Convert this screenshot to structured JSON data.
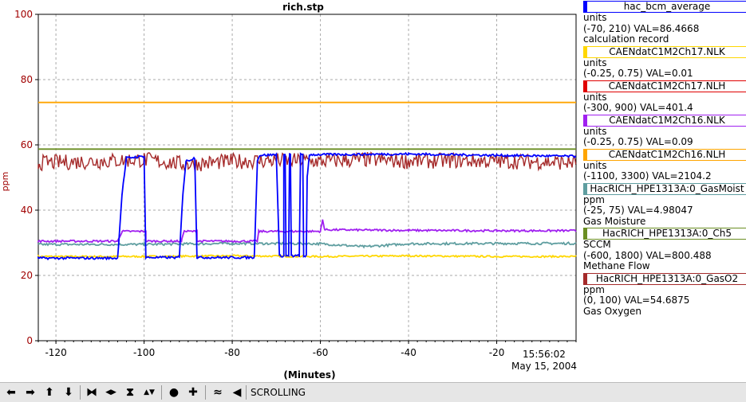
{
  "chart_data": {
    "type": "line",
    "title": "rich.stp",
    "xlabel": "(Minutes)",
    "ylabel": "ppm",
    "xlim": [
      -124,
      -2
    ],
    "ylim": [
      0,
      100
    ],
    "xticks": [
      -120,
      -100,
      -80,
      -60,
      -40,
      -20
    ],
    "yticks": [
      0,
      20,
      40,
      60,
      80,
      100
    ],
    "grid": true,
    "timestamp_time": "15:56:02",
    "timestamp_date": "May 15, 2004",
    "series": [
      {
        "name": "hac_bcm_average",
        "color": "#0000ff",
        "points": [
          [
            -124,
            25.3
          ],
          [
            -106,
            25.3
          ],
          [
            -105,
            45
          ],
          [
            -104,
            56
          ],
          [
            -100,
            56.5
          ],
          [
            -99.6,
            25.5
          ],
          [
            -92,
            25.5
          ],
          [
            -91.2,
            45
          ],
          [
            -90.5,
            55
          ],
          [
            -88.5,
            56
          ],
          [
            -88,
            25.5
          ],
          [
            -80,
            25.5
          ],
          [
            -75,
            25.5
          ],
          [
            -74.3,
            55
          ],
          [
            -73.8,
            56.8
          ],
          [
            -70,
            57
          ],
          [
            -69.3,
            26
          ],
          [
            -68.3,
            26
          ],
          [
            -68.3,
            57
          ],
          [
            -68,
            57
          ],
          [
            -67.8,
            26
          ],
          [
            -67.2,
            26
          ],
          [
            -67,
            57
          ],
          [
            -66.8,
            57
          ],
          [
            -66.6,
            26
          ],
          [
            -64.8,
            26
          ],
          [
            -64.5,
            57
          ],
          [
            -64,
            57
          ],
          [
            -63.8,
            26
          ],
          [
            -63.2,
            26
          ],
          [
            -63,
            50
          ],
          [
            -62.5,
            57
          ],
          [
            -40,
            57.2
          ],
          [
            -20,
            56.8
          ],
          [
            -2,
            56.5
          ]
        ]
      },
      {
        "name": "CAENdatC1M2Ch17.NLK",
        "color": "#ffd700",
        "points": [
          [
            -124,
            25.8
          ],
          [
            -100,
            25.8
          ],
          [
            -80,
            26
          ],
          [
            -60,
            25.8
          ],
          [
            -40,
            26
          ],
          [
            -20,
            25.8
          ],
          [
            -2,
            25.8
          ]
        ]
      },
      {
        "name": "CAENdatC1M2Ch17.NLH",
        "color": "#e00000",
        "points": []
      },
      {
        "name": "CAENdatC1M2Ch16.NLK",
        "color": "#a020f0",
        "points": [
          [
            -124,
            30.5
          ],
          [
            -106,
            30.5
          ],
          [
            -105,
            33.5
          ],
          [
            -99.6,
            33.5
          ],
          [
            -99.6,
            30.5
          ],
          [
            -91.5,
            30.5
          ],
          [
            -91,
            33.5
          ],
          [
            -88,
            33.5
          ],
          [
            -88,
            30.5
          ],
          [
            -74.3,
            30.5
          ],
          [
            -74,
            33.5
          ],
          [
            -60,
            33.5
          ],
          [
            -59.5,
            37
          ],
          [
            -59,
            34
          ],
          [
            -40,
            33.8
          ],
          [
            -20,
            33.7
          ],
          [
            -2,
            33.7
          ]
        ]
      },
      {
        "name": "CAENdatC1M2Ch16.NLH",
        "color": "#ffa500",
        "points": [
          [
            -124,
            73
          ],
          [
            -2,
            73
          ]
        ]
      },
      {
        "name": "HacRICH_HPE1313A:0_GasMoist",
        "color": "#5f9ea0",
        "points": [
          [
            -124,
            29.5
          ],
          [
            -100,
            29.5
          ],
          [
            -80,
            29.8
          ],
          [
            -60,
            29.7
          ],
          [
            -50,
            28.8
          ],
          [
            -40,
            29.7
          ],
          [
            -20,
            29.8
          ],
          [
            -2,
            29.8
          ]
        ]
      },
      {
        "name": "HacRICH_HPE1313A:0_Ch5",
        "color": "#6b8e23",
        "points": [
          [
            -124,
            58.7
          ],
          [
            -2,
            58.7
          ]
        ]
      },
      {
        "name": "HacRICH_HPE1313A:0_GasO2",
        "color": "#a52a2a",
        "points": [
          [
            -124,
            54.5
          ],
          [
            -110,
            55
          ],
          [
            -100,
            55.5
          ],
          [
            -90,
            54
          ],
          [
            -80,
            55
          ],
          [
            -70,
            55.2
          ],
          [
            -60,
            55
          ],
          [
            -50,
            55.5
          ],
          [
            -40,
            55
          ],
          [
            -30,
            55.2
          ],
          [
            -20,
            55
          ],
          [
            -10,
            54.8
          ],
          [
            -2,
            54.5
          ]
        ]
      }
    ]
  },
  "legend": [
    {
      "name": "hac_bcm_average",
      "color": "#0000ff",
      "lines": [
        "units",
        "(-70, 210) VAL=86.4668",
        "calculation record"
      ]
    },
    {
      "name": "CAENdatC1M2Ch17.NLK",
      "color": "#ffd700",
      "lines": [
        "units",
        "(-0.25, 0.75) VAL=0.01"
      ]
    },
    {
      "name": "CAENdatC1M2Ch17.NLH",
      "color": "#e00000",
      "lines": [
        "units",
        "(-300, 900) VAL=401.4"
      ]
    },
    {
      "name": "CAENdatC1M2Ch16.NLK",
      "color": "#a020f0",
      "lines": [
        "units",
        "(-0.25, 0.75) VAL=0.09"
      ]
    },
    {
      "name": "CAENdatC1M2Ch16.NLH",
      "color": "#ffa500",
      "lines": [
        "units",
        "(-1100, 3300) VAL=2104.2"
      ]
    },
    {
      "name": "HacRICH_HPE1313A:0_GasMoist",
      "color": "#5f9ea0",
      "lines": [
        "ppm",
        "(-25, 75) VAL=4.98047",
        "Gas Moisture"
      ]
    },
    {
      "name": "HacRICH_HPE1313A:0_Ch5",
      "color": "#6b8e23",
      "lines": [
        "SCCM",
        "(-600, 1800) VAL=800.488",
        "Methane Flow"
      ]
    },
    {
      "name": "HacRICH_HPE1313A:0_GasO2",
      "color": "#a52a2a",
      "lines": [
        "ppm",
        "(0, 100) VAL=54.6875",
        "Gas Oxygen"
      ]
    }
  ],
  "toolbar": {
    "buttons": [
      {
        "name": "scroll-left-button",
        "icon": "arrow-left-icon",
        "glyph": "⬅"
      },
      {
        "name": "scroll-right-button",
        "icon": "arrow-right-icon",
        "glyph": "➡"
      },
      {
        "name": "scroll-up-button",
        "icon": "arrow-up-icon",
        "glyph": "⬆"
      },
      {
        "name": "scroll-down-button",
        "icon": "arrow-down-icon",
        "glyph": "⬇"
      },
      {
        "name": "compress-x-button",
        "icon": "compress-horizontal-icon",
        "glyph": "⧓"
      },
      {
        "name": "expand-x-button",
        "icon": "expand-horizontal-icon",
        "glyph": "◀▶"
      },
      {
        "name": "compress-y-button",
        "icon": "compress-vertical-icon",
        "glyph": "⧗"
      },
      {
        "name": "expand-y-button",
        "icon": "expand-vertical-icon",
        "glyph": "▲▼"
      },
      {
        "name": "zoom-out-button",
        "icon": "circle-icon",
        "glyph": "●"
      },
      {
        "name": "zoom-in-button",
        "icon": "plus-icon",
        "glyph": "✚"
      },
      {
        "name": "autoscale-button",
        "icon": "wave-icon",
        "glyph": "≈"
      },
      {
        "name": "scroll-mode-button",
        "icon": "scroll-back-icon",
        "glyph": "◀"
      }
    ],
    "mode_label": "SCROLLING"
  }
}
